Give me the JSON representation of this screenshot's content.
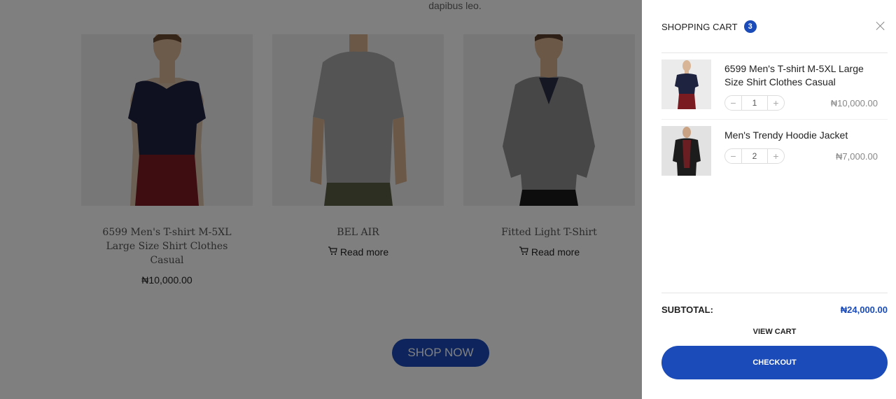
{
  "page": {
    "intro_text": "dapibus leo.",
    "products": [
      {
        "title": "6599 Men's T-shirt M-5XL Large Size Shirt Clothes Casual",
        "price": "₦10,000.00",
        "action": ""
      },
      {
        "title": "BEL AIR",
        "price": "",
        "action": "Read more"
      },
      {
        "title": "Fitted Light T-Shirt",
        "price": "",
        "action": "Read more"
      }
    ],
    "shop_now_label": "SHOP NOW"
  },
  "cart": {
    "title": "SHOPPING CART",
    "count": "3",
    "items": [
      {
        "name": "6599 Men's T-shirt M-5XL Large Size Shirt Clothes Casual",
        "qty": "1",
        "price": "₦10,000.00"
      },
      {
        "name": "Men's Trendy Hoodie Jacket",
        "qty": "2",
        "price": "₦7,000.00"
      }
    ],
    "subtotal_label": "SUBTOTAL:",
    "subtotal_value": "₦24,000.00",
    "view_cart_label": "VIEW CART",
    "checkout_label": "CHECKOUT"
  },
  "colors": {
    "accent": "#1a4bb8",
    "overlay": "rgba(0,0,0,0.5)"
  },
  "icons": [
    "cart-icon",
    "close-icon",
    "minus-icon",
    "plus-icon"
  ]
}
